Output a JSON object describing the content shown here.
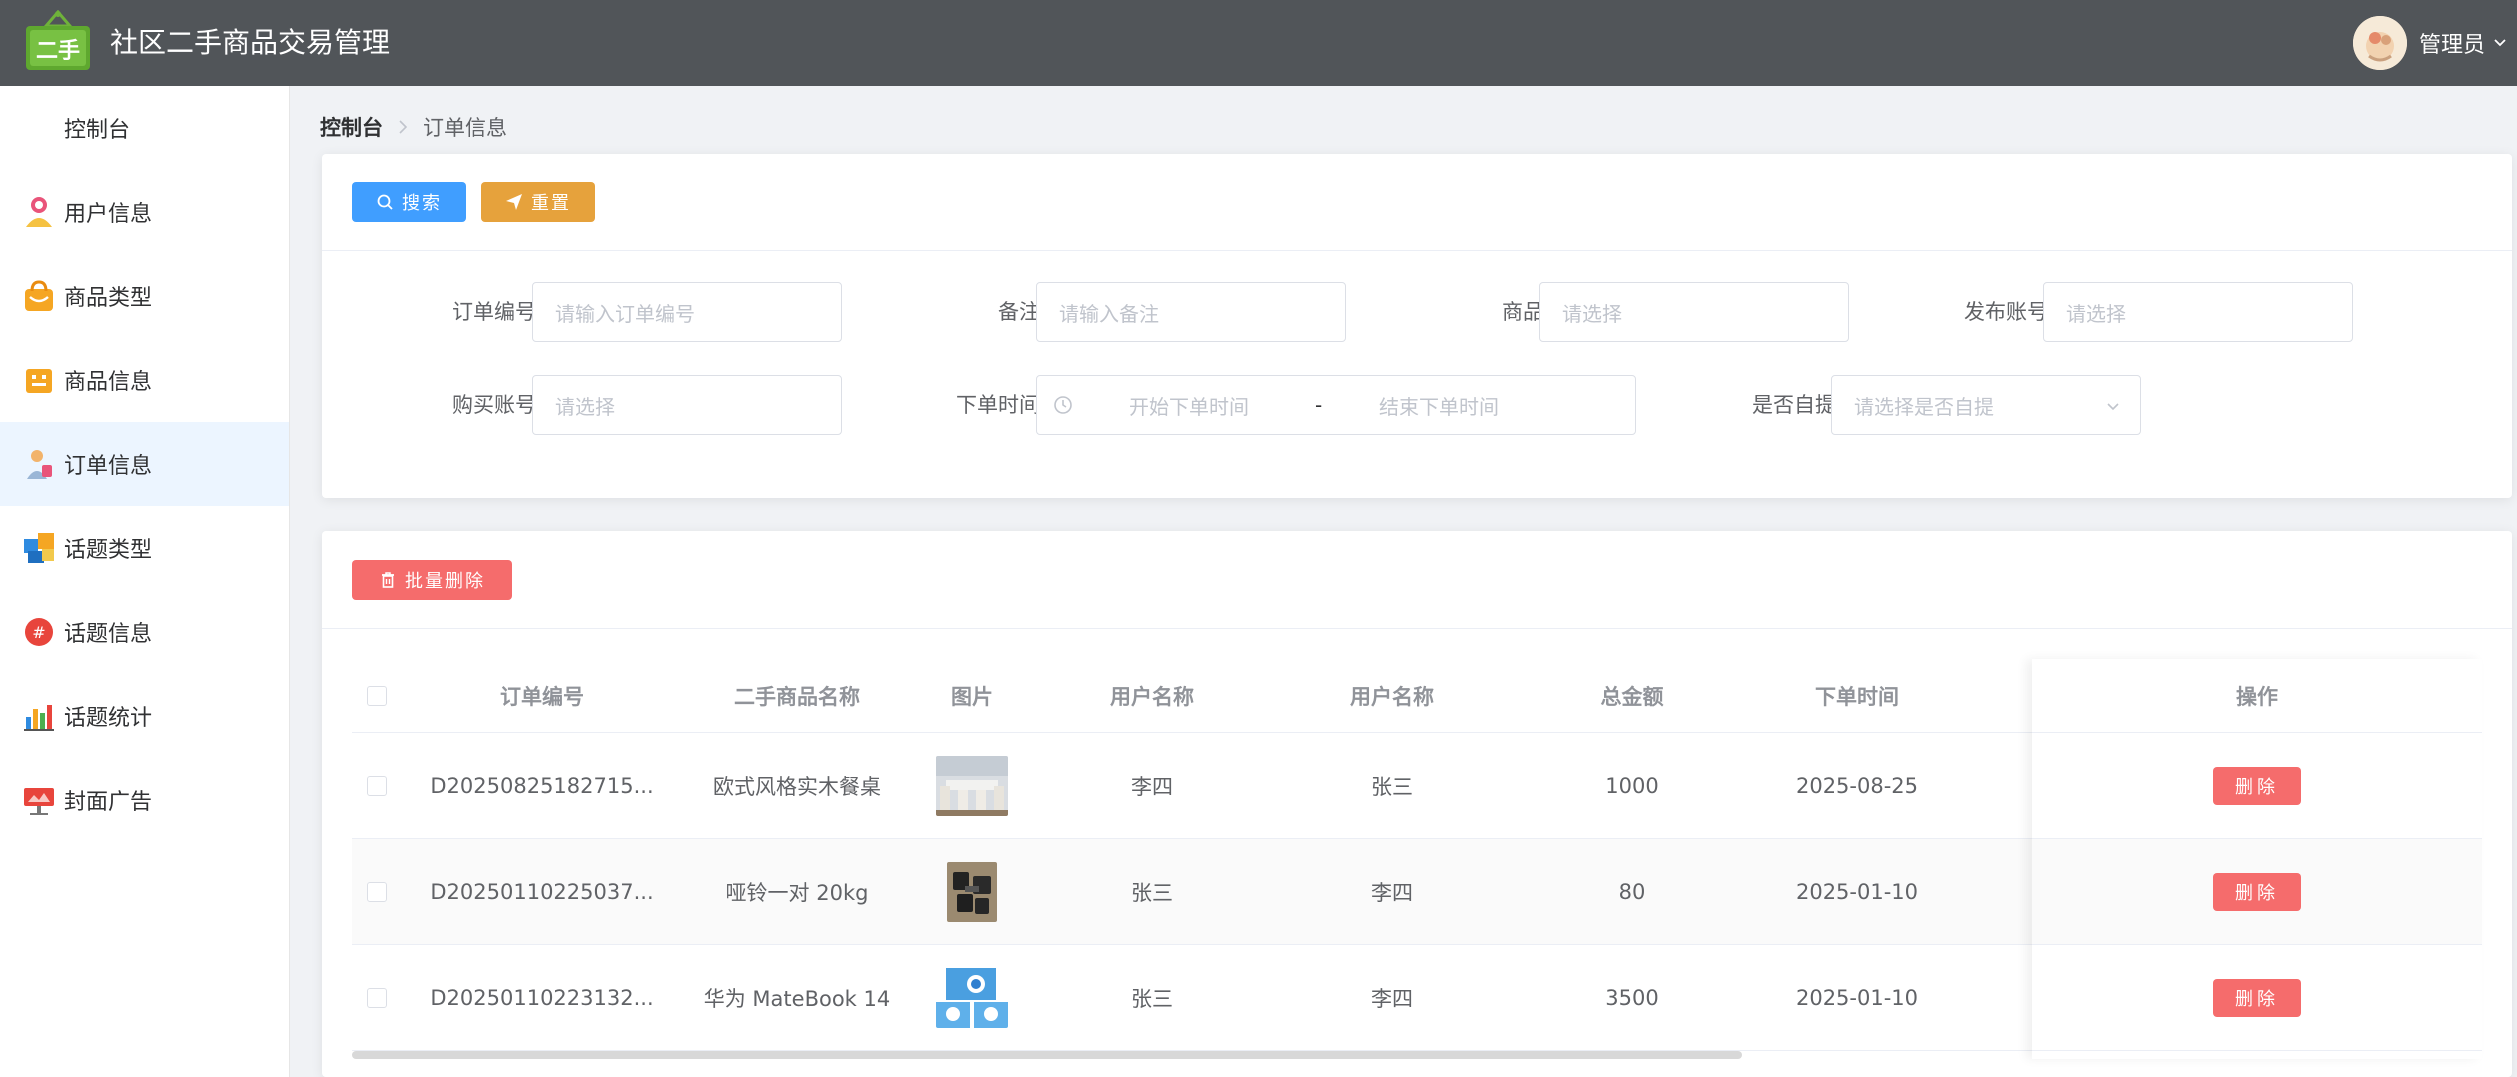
{
  "header": {
    "logo_text": "二手",
    "title": "社区二手商品交易管理",
    "user_name": "管理员"
  },
  "sidebar": {
    "items": [
      {
        "label": "控制台",
        "icon": "none"
      },
      {
        "label": "用户信息",
        "icon": "user-icon"
      },
      {
        "label": "商品类型",
        "icon": "shopping-bag-icon"
      },
      {
        "label": "商品信息",
        "icon": "product-icon"
      },
      {
        "label": "订单信息",
        "icon": "order-icon"
      },
      {
        "label": "话题类型",
        "icon": "topic-type-icon"
      },
      {
        "label": "话题信息",
        "icon": "hashtag-icon"
      },
      {
        "label": "话题统计",
        "icon": "bar-chart-icon"
      },
      {
        "label": "封面广告",
        "icon": "billboard-icon"
      }
    ],
    "active_index": 4
  },
  "breadcrumb": {
    "root": "控制台",
    "current": "订单信息"
  },
  "search": {
    "search_label": "搜索",
    "reset_label": "重置",
    "fields": {
      "order_no": {
        "label": "订单编号",
        "placeholder": "请输入订单编号"
      },
      "remark": {
        "label": "备注",
        "placeholder": "请输入备注"
      },
      "product": {
        "label": "商品",
        "placeholder": "请选择"
      },
      "publisher": {
        "label": "发布账号",
        "placeholder": "请选择"
      },
      "buyer": {
        "label": "购买账号",
        "placeholder": "请选择"
      },
      "order_time": {
        "label": "下单时间",
        "start_placeholder": "开始下单时间",
        "separator": "-",
        "end_placeholder": "结束下单时间"
      },
      "self_pickup": {
        "label": "是否自提",
        "placeholder": "请选择是否自提"
      }
    }
  },
  "list": {
    "batch_delete_label": "批量删除",
    "columns": [
      "订单编号",
      "二手商品名称",
      "图片",
      "用户名称",
      "用户名称",
      "总金额",
      "下单时间",
      "操作"
    ],
    "rows": [
      {
        "order_no": "D20250825182715...",
        "product": "欧式风格实木餐桌",
        "image": "dining-table-photo",
        "user1": "李四",
        "user2": "张三",
        "amount": "1000",
        "time": "2025-08-25",
        "action": "删除"
      },
      {
        "order_no": "D20250110225037...",
        "product": "哑铃一对 20kg",
        "image": "dumbbell-photo",
        "user1": "张三",
        "user2": "李四",
        "amount": "80",
        "time": "2025-01-10",
        "action": "删除"
      },
      {
        "order_no": "D20250110223132...",
        "product": "华为 MateBook 14",
        "image": "laptop-photo",
        "user1": "张三",
        "user2": "李四",
        "amount": "3500",
        "time": "2025-01-10",
        "action": "删除"
      }
    ]
  },
  "colors": {
    "header_bg": "#515559",
    "primary": "#409eff",
    "warning": "#e6a23c",
    "danger": "#f56c6c",
    "active_bg": "#ecf5ff"
  }
}
